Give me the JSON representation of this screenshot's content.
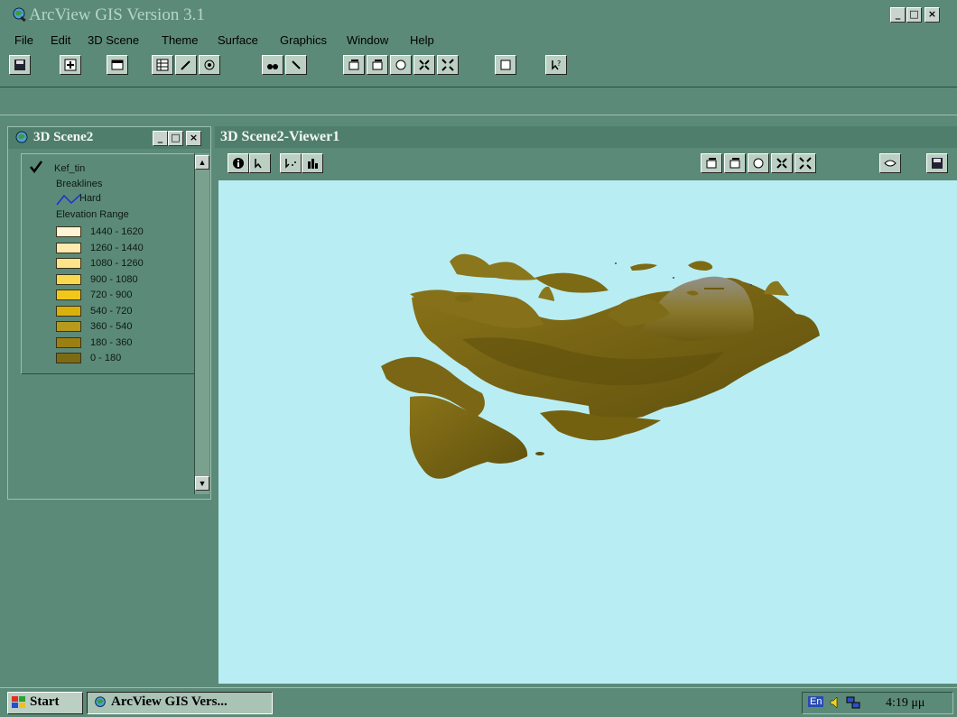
{
  "app": {
    "title": "ArcView GIS Version 3.1",
    "minimize": "_",
    "maximize": "□",
    "close": "×"
  },
  "menu": [
    "File",
    "Edit",
    "3D Scene",
    "Theme",
    "Surface",
    "Graphics",
    "Window",
    "Help"
  ],
  "scene_window": {
    "title": "3D Scene2",
    "legend": {
      "theme_name": "Kef_tin",
      "checked": true,
      "breaklines_label": "Breaklines",
      "hard_label": "Hard",
      "elevation_label": "Elevation Range",
      "ranges": [
        {
          "label": "1440 - 1620",
          "color": "#fff4d6"
        },
        {
          "label": "1260 - 1440",
          "color": "#ffeab0"
        },
        {
          "label": "1080 - 1260",
          "color": "#fde48a"
        },
        {
          "label": "900 - 1080",
          "color": "#f8d84e"
        },
        {
          "label": "720 - 900",
          "color": "#f2c71a"
        },
        {
          "label": "540 - 720",
          "color": "#d9b00c"
        },
        {
          "label": "360 - 540",
          "color": "#b79a1c"
        },
        {
          "label": "180 - 360",
          "color": "#9b7f12"
        },
        {
          "label": "0 - 180",
          "color": "#7d6a14"
        }
      ]
    }
  },
  "viewer": {
    "title": "3D Scene2-Viewer1",
    "background_color": "#b8eef3"
  },
  "taskbar": {
    "start_label": "Start",
    "task_label": "ArcView GIS Vers...",
    "tray_lang": "En",
    "clock": "4:19 μμ"
  },
  "colors": {
    "window_bg": "#5c8a78",
    "terrain_dark": "#6b5a0f",
    "terrain_mid": "#8a7419",
    "terrain_high": "#8c8e86"
  }
}
